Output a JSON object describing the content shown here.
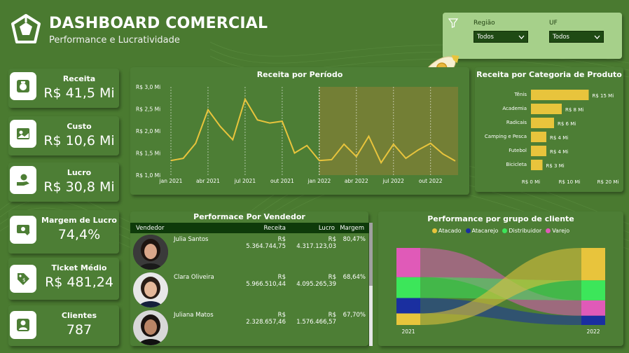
{
  "header": {
    "title": "DASHBOARD COMERCIAL",
    "subtitle": "Performance e Lucratividade"
  },
  "filters": {
    "regiao": {
      "label": "Região",
      "value": "Todos"
    },
    "uf": {
      "label": "UF",
      "value": "Todos"
    }
  },
  "kpis": [
    {
      "label": "Receita",
      "value": "R$ 41,5 Mi",
      "icon": "money-bag-icon"
    },
    {
      "label": "Custo",
      "value": "R$ 10,6 Mi",
      "icon": "cost-image-icon"
    },
    {
      "label": "Lucro",
      "value": "R$ 30,8 Mi",
      "icon": "hand-money-icon"
    },
    {
      "label": "Margem de Lucro",
      "value": "74,4%",
      "icon": "money-heart-icon"
    },
    {
      "label": "Ticket Médio",
      "value": "R$ 481,24",
      "icon": "price-tag-icon"
    },
    {
      "label": "Clientes",
      "value": "787",
      "icon": "client-icon"
    }
  ],
  "chart_data": [
    {
      "type": "line",
      "title": "Receita por Período",
      "x": [
        "jan 2021",
        "fev 2021",
        "mar 2021",
        "abr 2021",
        "mai 2021",
        "jun 2021",
        "jul 2021",
        "ago 2021",
        "set 2021",
        "out 2021",
        "nov 2021",
        "dez 2021",
        "jan 2022",
        "fev 2022",
        "mar 2022",
        "abr 2022",
        "mai 2022",
        "jun 2022",
        "jul 2022",
        "ago 2022",
        "set 2022",
        "out 2022",
        "nov 2022",
        "dez 2022"
      ],
      "x_tick_labels": [
        "jan 2021",
        "abr 2021",
        "jul 2021",
        "out 2021",
        "jan 2022",
        "abr 2022",
        "jul 2022",
        "out 2022"
      ],
      "y_tick_labels": [
        "R$ 1,0 Mi",
        "R$ 1,5 Mi",
        "R$ 2,0 Mi",
        "R$ 2,5 Mi",
        "R$ 3,0 Mi"
      ],
      "series": [
        {
          "values": [
            1.33,
            1.38,
            1.72,
            2.48,
            2.1,
            1.8,
            2.72,
            2.25,
            2.18,
            2.22,
            1.5,
            1.67,
            1.33,
            1.35,
            1.7,
            1.42,
            1.88,
            1.28,
            1.7,
            1.38,
            1.57,
            1.72,
            1.48,
            1.32
          ]
        }
      ],
      "ylim": [
        1.0,
        3.0
      ],
      "highlight_from": "jan 2022",
      "color": "#e8c43c"
    },
    {
      "type": "bar",
      "title": "Receita por Categoria de Produto",
      "categories": [
        "Tênis",
        "Academia",
        "Radicais",
        "Camping e Pesca",
        "Futebol",
        "Bicicleta"
      ],
      "values": [
        15,
        8,
        6,
        4,
        4,
        3
      ],
      "data_labels": [
        "R$ 15 Mi",
        "R$ 8 Mi",
        "R$ 6 Mi",
        "R$ 4 Mi",
        "R$ 4 Mi",
        "R$ 3 Mi"
      ],
      "x_tick_labels": [
        "R$ 0 Mi",
        "R$ 10 Mi",
        "R$ 20 Mi"
      ],
      "xlim": [
        0,
        20
      ],
      "orientation": "horizontal",
      "color": "#e8c43c"
    },
    {
      "type": "sankey",
      "title": "Performance por grupo de cliente",
      "sources": [
        "2021"
      ],
      "targets": [
        "2022"
      ],
      "series": [
        {
          "name": "Atacado",
          "color": "#e8c43c",
          "share_2021": 0.15,
          "share_2022": 0.42
        },
        {
          "name": "Atacarejo",
          "color": "#1a2fa0",
          "share_2021": 0.2,
          "share_2022": 0.12
        },
        {
          "name": "Distribuidor",
          "color": "#3ce65a",
          "share_2021": 0.27,
          "share_2022": 0.26
        },
        {
          "name": "Varejo",
          "color": "#e05ab8",
          "share_2021": 0.38,
          "share_2022": 0.2
        }
      ]
    }
  ],
  "vendors": {
    "title": "Performace Por Vendedor",
    "columns": [
      "Vendedor",
      "Receita",
      "Lucro",
      "Margem"
    ],
    "rows": [
      {
        "name": "Julia Santos",
        "receita": "R$ 5.364.744,75",
        "lucro": "R$ 4.317.123,03",
        "margem": "80,47%"
      },
      {
        "name": "Clara Oliveira",
        "receita": "R$ 5.966.510,44",
        "lucro": "R$ 4.095.265,39",
        "margem": "68,64%"
      },
      {
        "name": "Juliana Matos",
        "receita": "R$ 2.328.657,46",
        "lucro": "R$ 1.576.466,57",
        "margem": "67,70%"
      }
    ]
  }
}
